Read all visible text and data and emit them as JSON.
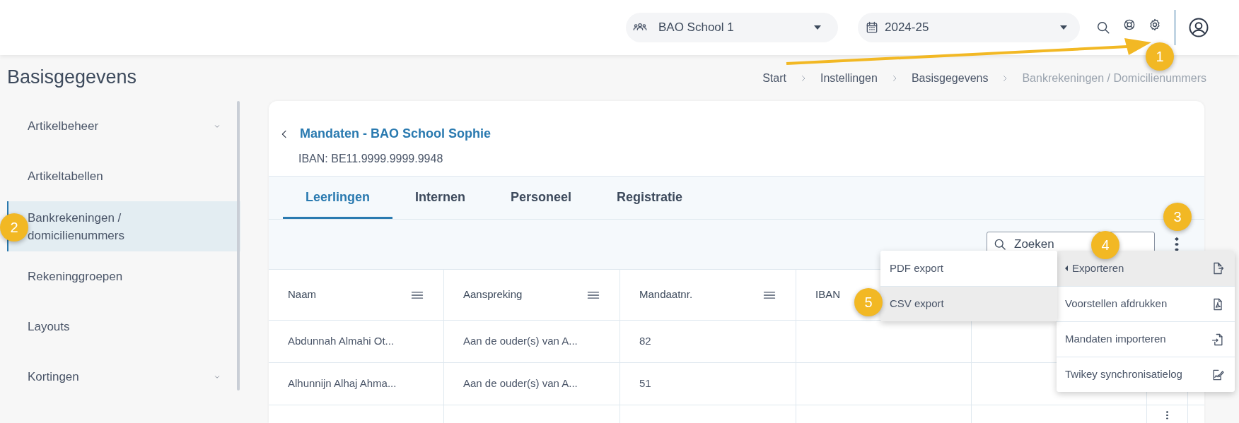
{
  "topbar": {
    "school_select": {
      "value": "BAO School 1"
    },
    "year_select": {
      "value": "2024-25"
    }
  },
  "page_title": "Basisgegevens",
  "breadcrumb": [
    {
      "label": "Start",
      "current": false
    },
    {
      "label": "Instellingen",
      "current": false
    },
    {
      "label": "Basisgegevens",
      "current": false
    },
    {
      "label": "Bankrekeningen / Domicilienummers",
      "current": true
    }
  ],
  "sidebar": {
    "items": [
      {
        "label": "Artikelbeheer",
        "expandable": true,
        "selected": false
      },
      {
        "label": "Artikeltabellen",
        "expandable": false,
        "selected": false
      },
      {
        "label": "Bankrekeningen / domicilienummers",
        "expandable": false,
        "selected": true
      },
      {
        "label": "Rekeninggroepen",
        "expandable": false,
        "selected": false
      },
      {
        "label": "Layouts",
        "expandable": false,
        "selected": false
      },
      {
        "label": "Kortingen",
        "expandable": true,
        "selected": false
      }
    ]
  },
  "card": {
    "title": "Mandaten - BAO School Sophie",
    "subtitle": "IBAN: BE11.9999.9999.9948",
    "tabs": [
      {
        "label": "Leerlingen",
        "selected": true
      },
      {
        "label": "Internen",
        "selected": false
      },
      {
        "label": "Personeel",
        "selected": false
      },
      {
        "label": "Registratie",
        "selected": false
      }
    ],
    "search": {
      "placeholder": "Zoeken"
    },
    "table": {
      "columns": [
        {
          "label": "Naam",
          "menu": true
        },
        {
          "label": "Aanspreking",
          "menu": true
        },
        {
          "label": "Mandaatnr.",
          "menu": true
        },
        {
          "label": "IBAN",
          "menu": false
        }
      ],
      "rows": [
        {
          "cells": [
            "Abdunnah Almahi Ot...",
            "Aan de ouder(s) van A...",
            "82"
          ],
          "actions_menu": false
        },
        {
          "cells": [
            "Alhunnijn Alhaj Ahma...",
            "Aan de ouder(s) van A...",
            "51"
          ],
          "actions_menu": false
        },
        {
          "cells": [],
          "actions_menu": true
        }
      ]
    }
  },
  "menu": {
    "items": [
      {
        "label": "Exporteren",
        "kind": "submenu",
        "highlighted": true
      },
      {
        "label": "Voorstellen afdrukken",
        "kind": "pdf",
        "highlighted": false
      },
      {
        "label": "Mandaten importeren",
        "kind": "import",
        "highlighted": false
      },
      {
        "label": "Twikey synchronisatielog",
        "kind": "log",
        "highlighted": false
      }
    ]
  },
  "submenu": {
    "items": [
      {
        "label": "PDF export",
        "highlighted": false
      },
      {
        "label": "CSV export",
        "highlighted": true
      }
    ]
  },
  "annotations": [
    {
      "label": "1"
    },
    {
      "label": "2"
    },
    {
      "label": "3"
    },
    {
      "label": "4"
    },
    {
      "label": "5"
    }
  ]
}
